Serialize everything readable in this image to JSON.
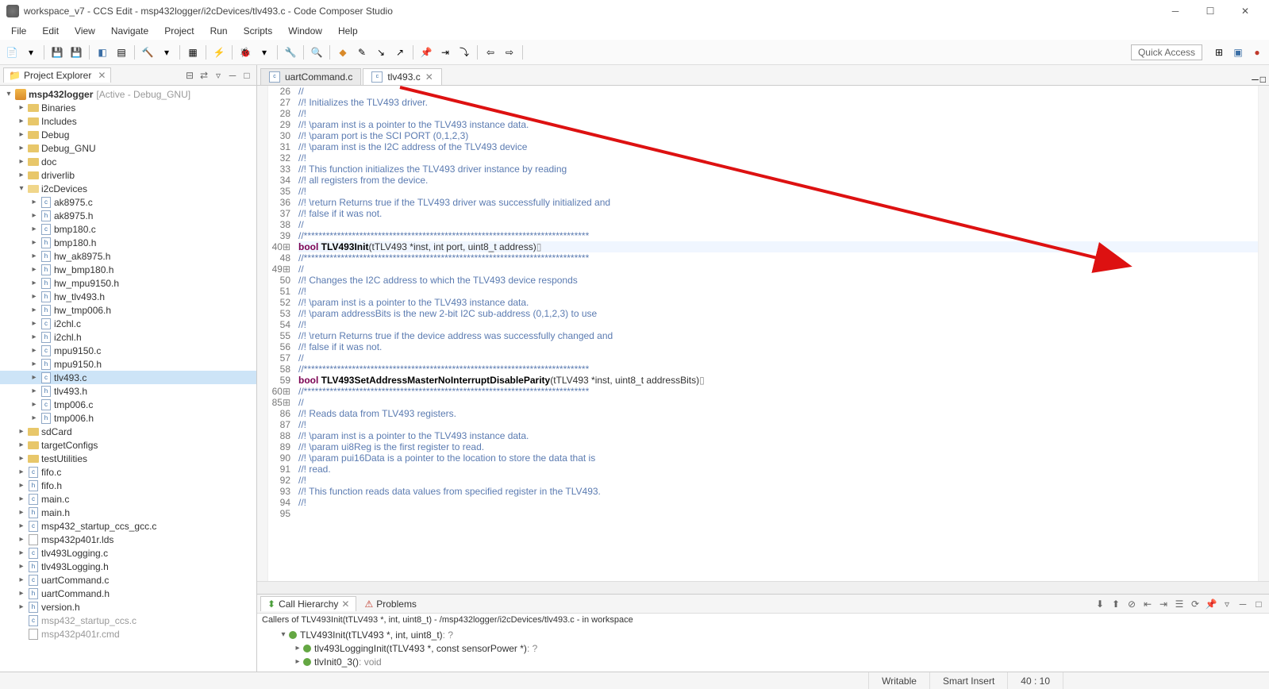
{
  "window": {
    "title": "workspace_v7 - CCS Edit - msp432logger/i2cDevices/tlv493.c - Code Composer Studio"
  },
  "menus": [
    "File",
    "Edit",
    "View",
    "Navigate",
    "Project",
    "Run",
    "Scripts",
    "Window",
    "Help"
  ],
  "quick_access": "Quick Access",
  "explorer": {
    "title": "Project Explorer",
    "project_label": "msp432logger",
    "project_decorator": "[Active - Debug_GNU]",
    "folders_top": [
      "Binaries",
      "Includes",
      "Debug",
      "Debug_GNU",
      "doc",
      "driverlib"
    ],
    "i2c_folder": "i2cDevices",
    "i2c_files": [
      "ak8975.c",
      "ak8975.h",
      "bmp180.c",
      "bmp180.h",
      "hw_ak8975.h",
      "hw_bmp180.h",
      "hw_mpu9150.h",
      "hw_tlv493.h",
      "hw_tmp006.h",
      "i2chl.c",
      "i2chl.h",
      "mpu9150.c",
      "mpu9150.h",
      "tlv493.c",
      "tlv493.h",
      "tmp006.c",
      "tmp006.h"
    ],
    "folders_mid": [
      "sdCard",
      "targetConfigs",
      "testUtilities"
    ],
    "root_files": [
      "fifo.c",
      "fifo.h",
      "main.c",
      "main.h",
      "msp432_startup_ccs_gcc.c",
      "msp432p401r.lds",
      "tlv493Logging.c",
      "tlv493Logging.h",
      "uartCommand.c",
      "uartCommand.h",
      "version.h"
    ],
    "root_files_dim": [
      "msp432_startup_ccs.c",
      "msp432p401r.cmd"
    ]
  },
  "editor": {
    "tabs": [
      "uartCommand.c",
      "tlv493.c"
    ],
    "gutter": [
      "26",
      "27",
      "28",
      "29",
      "30",
      "31",
      "32",
      "33",
      "34",
      "35",
      "36",
      "37",
      "38",
      "39",
      "40",
      "48",
      "49",
      "50",
      "51",
      "52",
      "53",
      "54",
      "55",
      "56",
      "57",
      "58",
      "59",
      "60",
      "85",
      "86",
      "87",
      "88",
      "89",
      "90",
      "91",
      "92",
      "93",
      "94",
      "95"
    ],
    "lines": [
      {
        "t": "//",
        "c": "cmt"
      },
      {
        "t": "//! Initializes the TLV493 driver.",
        "c": "cmt"
      },
      {
        "t": "//!",
        "c": "cmt"
      },
      {
        "t": "//! \\param inst is a pointer to the TLV493 instance data.",
        "c": "cmt"
      },
      {
        "t": "//! \\param port is the SCI PORT (0,1,2,3)",
        "c": "cmt"
      },
      {
        "t": "//! \\param inst is the I2C address of the TLV493 device",
        "c": "cmt"
      },
      {
        "t": "//!",
        "c": "cmt"
      },
      {
        "t": "//! This function initializes the TLV493 driver instance by reading",
        "c": "cmt"
      },
      {
        "t": "//! all registers from the device.",
        "c": "cmt"
      },
      {
        "t": "//!",
        "c": "cmt"
      },
      {
        "t": "//! \\return Returns true if the TLV493 driver was successfully initialized and",
        "c": "cmt"
      },
      {
        "t": "//! false if it was not.",
        "c": "cmt"
      },
      {
        "t": "//",
        "c": "cmt"
      },
      {
        "t": "//*****************************************************************************",
        "c": "cmt"
      },
      {
        "sig1": true
      },
      {
        "t": "",
        "c": ""
      },
      {
        "t": "//*****************************************************************************",
        "c": "cmt"
      },
      {
        "t": "//",
        "c": "cmt"
      },
      {
        "t": "//! Changes the I2C address to which the TLV493 device responds",
        "c": "cmt"
      },
      {
        "t": "//!",
        "c": "cmt"
      },
      {
        "t": "//! \\param inst is a pointer to the TLV493 instance data.",
        "c": "cmt"
      },
      {
        "t": "//! \\param addressBits is the new 2-bit I2C sub-address (0,1,2,3) to use",
        "c": "cmt"
      },
      {
        "t": "//!",
        "c": "cmt"
      },
      {
        "t": "//! \\return Returns true if the device address was successfully changed and",
        "c": "cmt"
      },
      {
        "t": "//! false if it was not.",
        "c": "cmt"
      },
      {
        "t": "//",
        "c": "cmt"
      },
      {
        "t": "//*****************************************************************************",
        "c": "cmt"
      },
      {
        "sig2": true
      },
      {
        "t": "//*****************************************************************************",
        "c": "cmt"
      },
      {
        "t": "//",
        "c": "cmt"
      },
      {
        "t": "//! Reads data from TLV493 registers.",
        "c": "cmt"
      },
      {
        "t": "//!",
        "c": "cmt"
      },
      {
        "t": "//! \\param inst is a pointer to the TLV493 instance data.",
        "c": "cmt"
      },
      {
        "t": "//! \\param ui8Reg is the first register to read.",
        "c": "cmt"
      },
      {
        "t": "//! \\param pui16Data is a pointer to the location to store the data that is",
        "c": "cmt"
      },
      {
        "t": "//! read.",
        "c": "cmt"
      },
      {
        "t": "//!",
        "c": "cmt"
      },
      {
        "t": "//! This function reads data values from specified register in the TLV493.",
        "c": "cmt"
      },
      {
        "t": "//!",
        "c": "cmt"
      }
    ],
    "sig1": {
      "kw": "bool ",
      "fn": "TLV493Init",
      "rest": "(tTLV493 *inst, int port, uint8_t address)"
    },
    "sig2": {
      "kw": "bool ",
      "fn": "TLV493SetAddressMasterNoInterruptDisableParity",
      "rest": "(tTLV493 *inst, uint8_t addressBits)"
    }
  },
  "bottom": {
    "tab_call": "Call Hierarchy",
    "tab_problems": "Problems",
    "callers_of": "Callers of TLV493Init(tTLV493 *, int, uint8_t) - /msp432logger/i2cDevices/tlv493.c - in workspace",
    "nodes": [
      {
        "label": "TLV493Init(tTLV493 *, int, uint8_t)",
        "ret": ": ?",
        "indent": 1,
        "exp": "▾"
      },
      {
        "label": "tlv493LoggingInit(tTLV493 *, const sensorPower *)",
        "ret": ": ?",
        "indent": 2,
        "exp": "▸"
      },
      {
        "label": "tlvInit0_3()",
        "ret": ": void",
        "indent": 2,
        "exp": "▸"
      }
    ]
  },
  "status": {
    "writable": "Writable",
    "insert": "Smart Insert",
    "pos": "40 : 10"
  }
}
